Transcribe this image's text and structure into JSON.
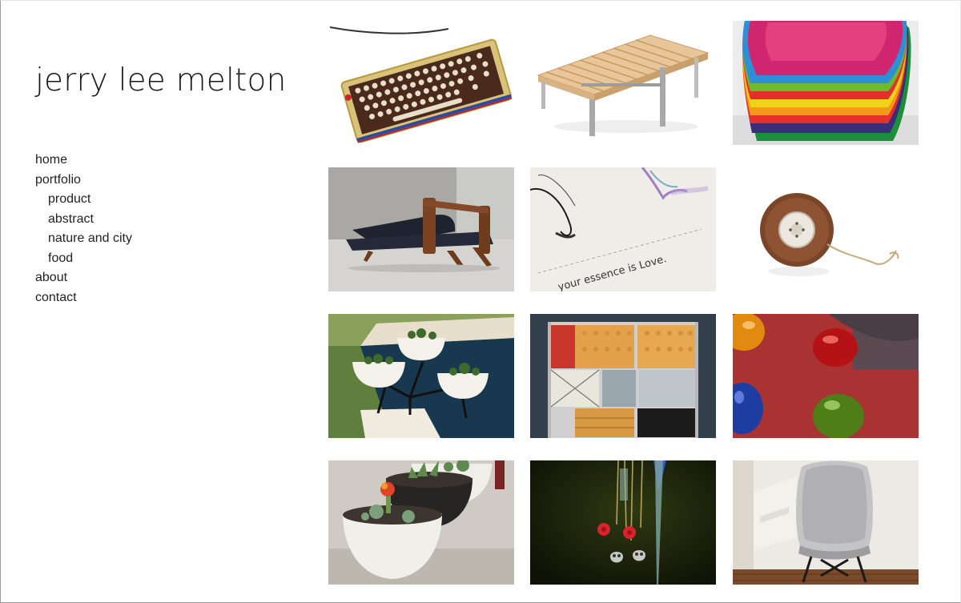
{
  "site": {
    "title": "jerry lee melton"
  },
  "nav": {
    "home": "home",
    "portfolio": "portfolio",
    "product": "product",
    "abstract": "abstract",
    "nature_and_city": "nature and city",
    "food": "food",
    "about": "about",
    "contact": "contact"
  },
  "gallery": {
    "tiles": [
      {
        "subject": "brass typewriter-style keyboard"
      },
      {
        "subject": "wooden slat bench"
      },
      {
        "subject": "stacked colorful chairs"
      },
      {
        "subject": "walnut and leather sofa"
      },
      {
        "subject": "watercolor paper print",
        "caption": "your essence is Love."
      },
      {
        "subject": "wooden yo-yo"
      },
      {
        "subject": "planter bowls by pool"
      },
      {
        "subject": "storage unit cabinet"
      },
      {
        "subject": "glass knobs on red surface"
      },
      {
        "subject": "succulent planters"
      },
      {
        "subject": "hanging charms"
      },
      {
        "subject": "silver shell chair"
      }
    ]
  },
  "colors": {
    "text": "#222222",
    "background": "#ffffff"
  }
}
